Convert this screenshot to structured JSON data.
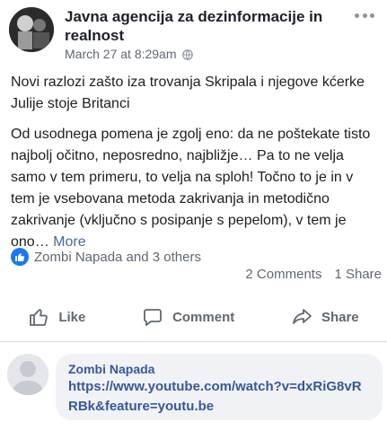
{
  "post": {
    "page_name": "Javna agencija za dezinformacije in realnost",
    "timestamp": "March 27 at 8:29am",
    "privacy_icon": "globe-icon",
    "title_line": "Novi razlozi zašto iza trovanja Skripala i njegove kćerke Julije stoje Britanci",
    "body": "Od usodnega pomena je zgolj eno: da ne poštekate tisto najbolj očitno, neposredno, najbližje… Pa to ne velja samo v tem primeru, to velja na sploh! Točno to je in v tem je vsebovana metoda zakrivanja in metodično zakrivanje (vključno s posipanje s pepelom), v tem je ono…",
    "more_label": "More"
  },
  "reactions": {
    "icon": "like-icon",
    "summary": "Zombi Napada and 3 others",
    "comments_count": "2 Comments",
    "shares_count": "1 Share"
  },
  "actions": {
    "like_label": "Like",
    "comment_label": "Comment",
    "share_label": "Share"
  },
  "comment": {
    "author": "Zombi Napada",
    "text": "https://www.youtube.com/watch?v=dxRiG8vRRBk&feature=youtu.be"
  },
  "colors": {
    "link": "#385898",
    "like_blue": "#1877f2",
    "muted": "#606770"
  }
}
